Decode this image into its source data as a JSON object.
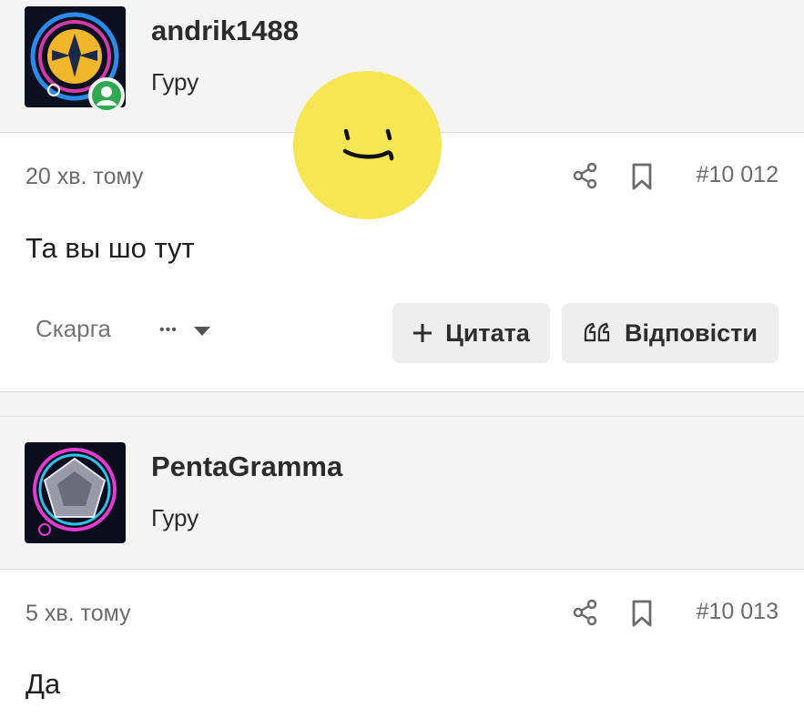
{
  "posts": [
    {
      "username": "andrik1488",
      "rank": "Гуру",
      "time": "20 хв. тому",
      "post_number": "#10 012",
      "content": "Та вы шо тут",
      "actions": {
        "report": "Скарга",
        "more": "•••",
        "quote": "Цитата",
        "reply": "Відповісти"
      }
    },
    {
      "username": "PentaGramma",
      "rank": "Гуру",
      "time": "5 хв. тому",
      "post_number": "#10 013",
      "content": "Да"
    }
  ],
  "colors": {
    "online": "#2fa84f",
    "button_bg": "#eeeeee",
    "sticker": "#f7e654"
  },
  "icons": [
    "share-icon",
    "bookmark-icon",
    "plus-icon",
    "quote-icon",
    "caret-down-icon",
    "user-icon"
  ]
}
